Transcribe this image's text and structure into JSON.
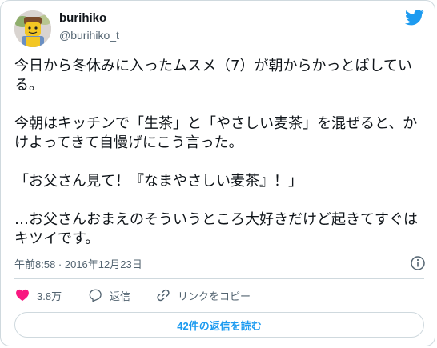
{
  "author": {
    "display_name": "burihiko",
    "handle": "@burihiko_t",
    "avatar_icon": "lego-minifigure-avatar"
  },
  "tweet": {
    "paragraphs": [
      "今日から冬休みに入ったムスメ（7）が朝からかっとばしている。",
      "今朝はキッチンで「生茶」と「やさしい麦茶」を混ぜると、かけよってきて自慢げにこう言った。",
      "「お父さん見て！『なまやさしい麦茶』！」",
      "…お父さんおまえのそういうところ大好きだけど起きてすぐはキツイです。"
    ],
    "timestamp": "午前8:58 · 2016年12月23日"
  },
  "actions": {
    "likes_count": "3.8万",
    "reply_label": "返信",
    "copy_link_label": "リンクをコピー"
  },
  "replies_button_label": "42件の返信を読む",
  "colors": {
    "accent": "#1d9bf0",
    "like": "#f91880",
    "text_secondary": "#536471",
    "border": "#cfd9de"
  }
}
